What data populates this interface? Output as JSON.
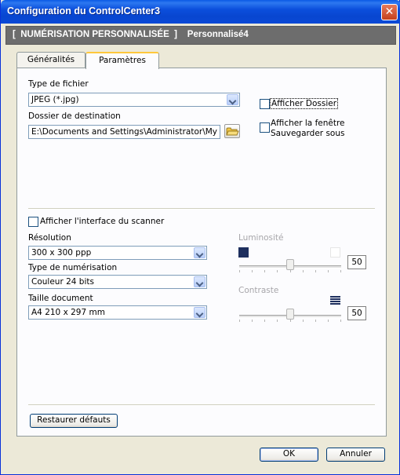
{
  "window": {
    "title": "Configuration du ControlCenter3"
  },
  "header": {
    "text": "[  NUMÉRISATION PERSONNALISÉE  ]    Personnalisé4"
  },
  "tabs": [
    {
      "label": "Généralités",
      "active": false
    },
    {
      "label": "Paramètres",
      "active": true
    }
  ],
  "file": {
    "type_label": "Type de fichier",
    "type_value": "JPEG (*.jpg)",
    "dest_label": "Dossier de destination",
    "dest_value": "E:\\Documents and Settings\\Administrator\\My Docum",
    "show_folder_label": "Afficher Dossier",
    "show_save_as_label_1": "Afficher la fenêtre",
    "show_save_as_label_2": "Sauvegarder sous"
  },
  "scanner": {
    "show_interface_label": "Afficher l'interface du scanner",
    "resolution_label": "Résolution",
    "resolution_value": "300 x 300 ppp",
    "scan_type_label": "Type de numérisation",
    "scan_type_value": "Couleur 24 bits",
    "doc_size_label": "Taille document",
    "doc_size_value": "A4 210 x 297 mm",
    "brightness_label": "Luminosité",
    "brightness_value": "50",
    "contrast_label": "Contraste",
    "contrast_value": "50"
  },
  "buttons": {
    "restore": "Restaurer défauts",
    "ok": "OK",
    "cancel": "Annuler"
  },
  "colors": {
    "titlebar": "#0a49d6",
    "header_bar": "#6d6d6d",
    "tab_highlight": "#ffc83c"
  }
}
